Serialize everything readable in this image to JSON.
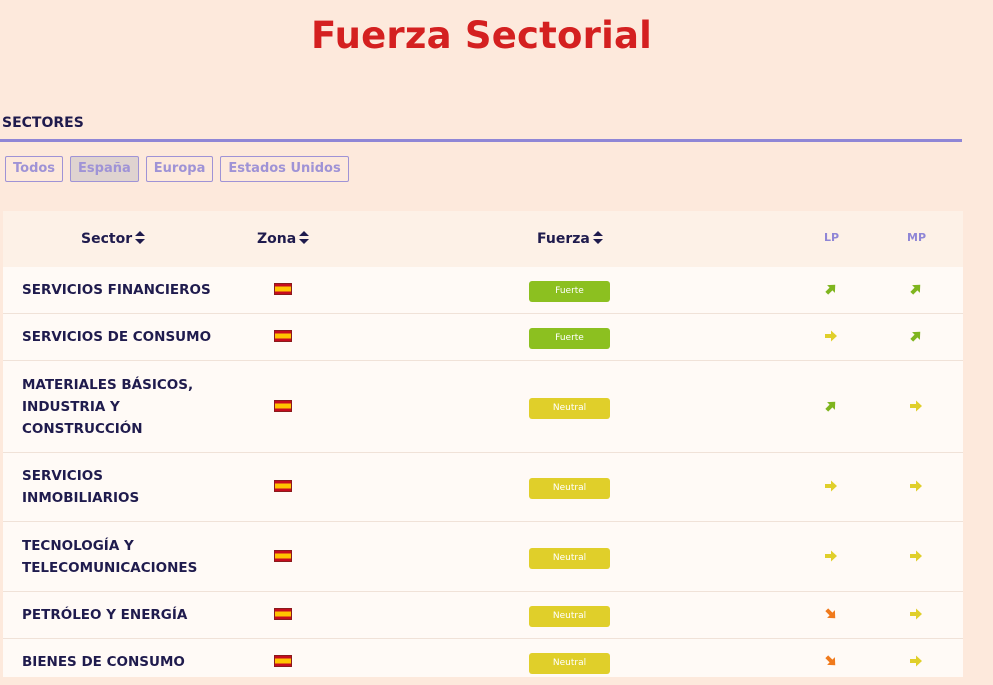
{
  "page": {
    "title": "Fuerza Sectorial"
  },
  "section": {
    "label": "SECTORES"
  },
  "filters": [
    {
      "label": "Todos",
      "active": false
    },
    {
      "label": "España",
      "active": true
    },
    {
      "label": "Europa",
      "active": false
    },
    {
      "label": "Estados Unidos",
      "active": false
    }
  ],
  "table": {
    "headers": {
      "sector": "Sector",
      "zona": "Zona",
      "fuerza": "Fuerza",
      "lp": "LP",
      "mp": "MP"
    },
    "rows": [
      {
        "sector": "SERVICIOS FINANCIEROS",
        "zona_icon": "spain-flag-icon",
        "fuerza": "Fuerte",
        "lp": "up",
        "mp": "up"
      },
      {
        "sector": "SERVICIOS DE CONSUMO",
        "zona_icon": "spain-flag-icon",
        "fuerza": "Fuerte",
        "lp": "flat",
        "mp": "up"
      },
      {
        "sector": "MATERIALES BÁSICOS,\nINDUSTRIA Y\nCONSTRUCCIÓN",
        "zona_icon": "spain-flag-icon",
        "fuerza": "Neutral",
        "lp": "up",
        "mp": "flat"
      },
      {
        "sector": "SERVICIOS\nINMOBILIARIOS",
        "zona_icon": "spain-flag-icon",
        "fuerza": "Neutral",
        "lp": "flat",
        "mp": "flat"
      },
      {
        "sector": "TECNOLOGÍA Y\nTELECOMUNICACIONES",
        "zona_icon": "spain-flag-icon",
        "fuerza": "Neutral",
        "lp": "flat",
        "mp": "flat"
      },
      {
        "sector": "PETRÓLEO Y ENERGÍA",
        "zona_icon": "spain-flag-icon",
        "fuerza": "Neutral",
        "lp": "down",
        "mp": "flat"
      },
      {
        "sector": "BIENES DE CONSUMO",
        "zona_icon": "spain-flag-icon",
        "fuerza": "Neutral",
        "lp": "down",
        "mp": "flat"
      }
    ]
  },
  "colors": {
    "title": "#d42020",
    "fuerte": "#8cc020",
    "neutral": "#e0cf2a",
    "arrow_up": "#7fb51f",
    "arrow_flat": "#e0cf2a",
    "arrow_down": "#f07a1c"
  }
}
